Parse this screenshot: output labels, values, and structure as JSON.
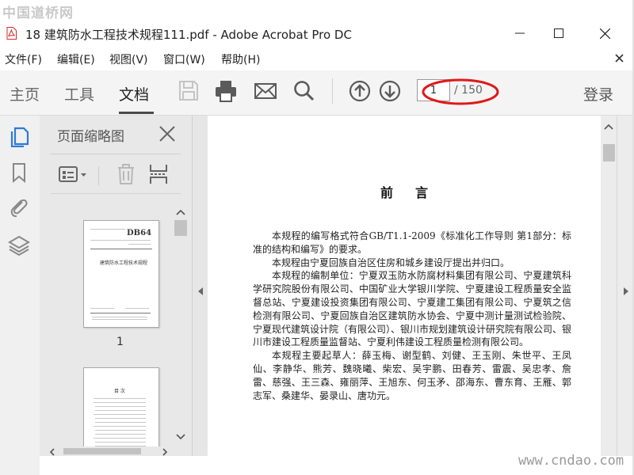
{
  "window": {
    "watermark": "中国道桥网",
    "title": "18 建筑防水工程技术规程111.pdf - Adobe Acrobat Pro DC"
  },
  "menu": {
    "items": [
      {
        "label": "文件(F)"
      },
      {
        "label": "编辑(E)"
      },
      {
        "label": "视图(V)"
      },
      {
        "label": "窗口(W)"
      },
      {
        "label": "帮助(H)"
      }
    ]
  },
  "toolbar": {
    "tabs": [
      {
        "label": "主页"
      },
      {
        "label": "工具"
      },
      {
        "label": "文档",
        "active": true
      }
    ],
    "icons": [
      "save-icon",
      "print-icon",
      "email-icon",
      "search-icon",
      "page-up-icon",
      "page-down-icon"
    ],
    "page_input": {
      "value": "1"
    },
    "page_total": "/ 150",
    "login_label": "登录",
    "annotation_color": "#e01919"
  },
  "left_rail": {
    "icons": [
      "page-thumbnails-icon",
      "bookmarks-icon",
      "attachments-icon",
      "layers-icon"
    ],
    "active_color": "#2d7ad6"
  },
  "thumbnail_panel": {
    "title": "页面缩略图",
    "tool_icons": [
      "thumbnail-options-icon",
      "delete-page-icon",
      "extract-page-icon"
    ],
    "thumbnails": [
      {
        "page_label": "1",
        "code": "DB64",
        "title": "建筑防水工程技术规程"
      },
      {
        "page_label": "",
        "heading": "目 次"
      }
    ]
  },
  "document": {
    "heading": "前言",
    "paragraphs": [
      "本规程的编写格式符合GB/T1.1-2009《标准化工作导则 第1部分：标准的结构和编写》的要求。",
      "本规程由宁夏回族自治区住房和城乡建设厅提出并归口。",
      "本规程的编制单位：宁夏双玉防水防腐材料集团有限公司、宁夏建筑科学研究院股份有限公司、中国矿业大学银川学院、宁夏建设工程质量安全监督总站、宁夏建设投资集团有限公司、宁夏建工集团有限公司、宁夏筑之信检测有限公司、宁夏回族自治区建筑防水协会、宁夏中测计量测试检验院、宁夏现代建筑设计院（有限公司）、银川市规划建筑设计研究院有限公司、银川市建设工程质量监督站、宁夏利伟建设工程质量检测有限公司。",
      "本规程主要起草人：薛玉梅、谢型鹤、刘健、王玉刚、朱世平、王凤仙、李静华、熊芳、魏晓曦、柴宏、吴宇鹏、田春芳、雷震、吴忠孝、詹雷、慈强、王三森、雍丽萍、王旭东、何玉矛、邵海东、曹东育、王雁、郭志军、桑建华、晏录山、唐功元。"
    ]
  },
  "footer": {
    "watermark": "www.cndao.com"
  }
}
